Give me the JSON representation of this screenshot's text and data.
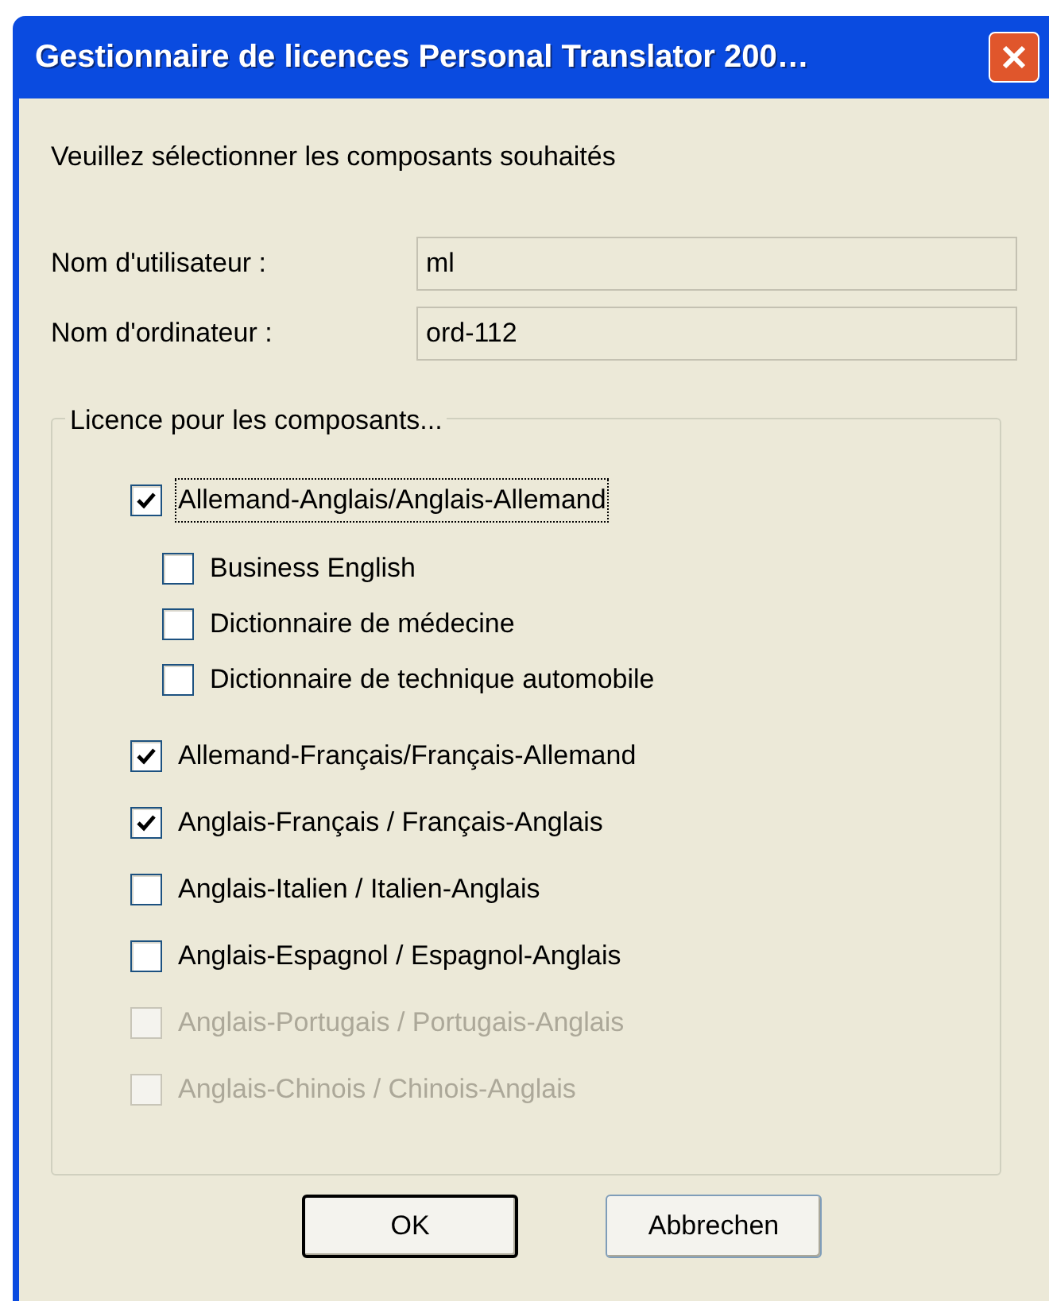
{
  "window": {
    "title": "Gestionnaire de licences Personal Translator 200…"
  },
  "intro": "Veuillez sélectionner les composants souhaités",
  "fields": [
    {
      "label": "Nom d'utilisateur :",
      "value": "ml"
    },
    {
      "label": "Nom d'ordinateur :",
      "value": "ord-112"
    }
  ],
  "group": {
    "legend": "Licence pour les composants...",
    "items": [
      {
        "label": "Allemand-Anglais/Anglais-Allemand",
        "checked": true,
        "disabled": false,
        "focused": true,
        "children": [
          {
            "label": "Business English",
            "checked": false,
            "disabled": false,
            "focused": false
          },
          {
            "label": "Dictionnaire de médecine",
            "checked": false,
            "disabled": false,
            "focused": false
          },
          {
            "label": "Dictionnaire de technique automobile",
            "checked": false,
            "disabled": false,
            "focused": false
          }
        ]
      },
      {
        "label": "Allemand-Français/Français-Allemand",
        "checked": true,
        "disabled": false,
        "focused": false
      },
      {
        "label": "Anglais-Français / Français-Anglais",
        "checked": true,
        "disabled": false,
        "focused": false
      },
      {
        "label": "Anglais-Italien / Italien-Anglais",
        "checked": false,
        "disabled": false,
        "focused": false
      },
      {
        "label": "Anglais-Espagnol / Espagnol-Anglais",
        "checked": false,
        "disabled": false,
        "focused": false
      },
      {
        "label": "Anglais-Portugais / Portugais-Anglais",
        "checked": false,
        "disabled": true,
        "focused": false
      },
      {
        "label": "Anglais-Chinois / Chinois-Anglais",
        "checked": false,
        "disabled": true,
        "focused": false
      }
    ]
  },
  "buttons": [
    {
      "label": "OK",
      "default": true
    },
    {
      "label": "Abbrechen",
      "default": false
    }
  ]
}
